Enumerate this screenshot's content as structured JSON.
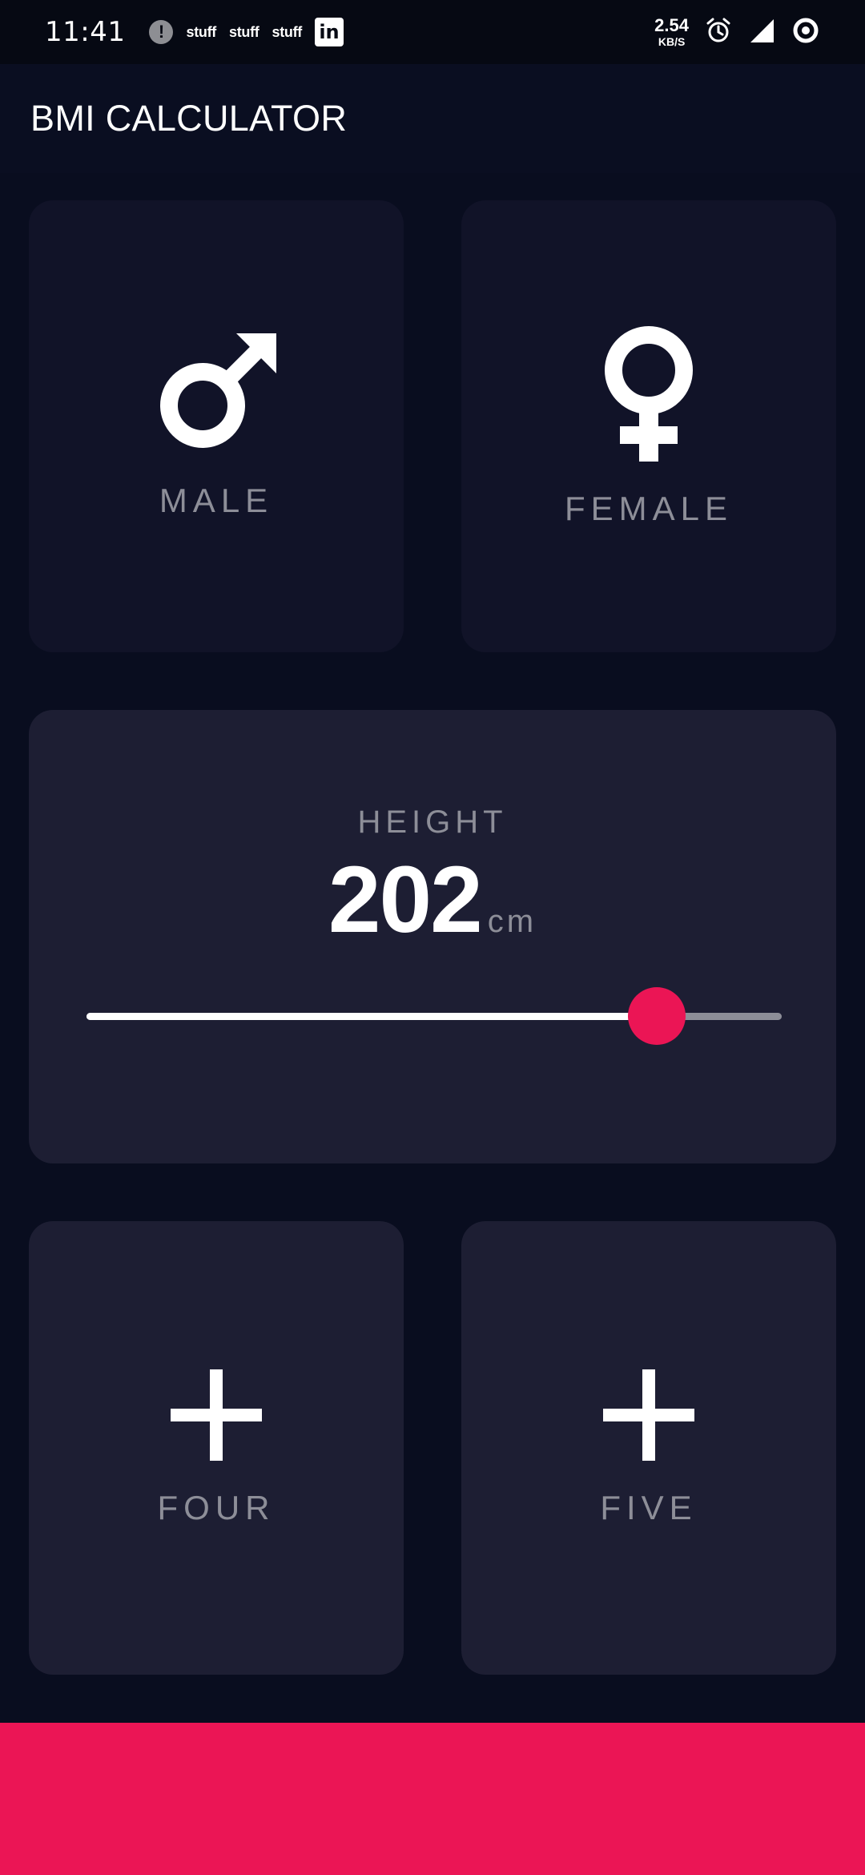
{
  "status_bar": {
    "time": "11:41",
    "alert_icon": "!",
    "stuff_items": [
      "stuff",
      "stuff",
      "stuff"
    ],
    "linkedin_icon": "in",
    "net_speed_value": "2.54",
    "net_speed_unit": "KB/S",
    "icons": [
      "alarm-icon",
      "signal-icon",
      "data-saver-icon"
    ]
  },
  "app_bar": {
    "title": "BMI CALCULATOR"
  },
  "gender": {
    "male_label": "MALE",
    "female_label": "FEMALE",
    "male_icon": "mars-icon",
    "female_icon": "venus-icon"
  },
  "height": {
    "label": "HEIGHT",
    "value": "202",
    "unit": "cm",
    "slider_fraction": 0.82
  },
  "cards": {
    "four_label": "FOUR",
    "five_label": "FIVE",
    "four_icon": "plus-icon",
    "five_icon": "plus-icon"
  },
  "colors": {
    "background": "#090d1f",
    "card_active": "#1d1e33",
    "card_inactive": "#111328",
    "accent": "#eb1555",
    "label_gray": "#8d8e98"
  }
}
